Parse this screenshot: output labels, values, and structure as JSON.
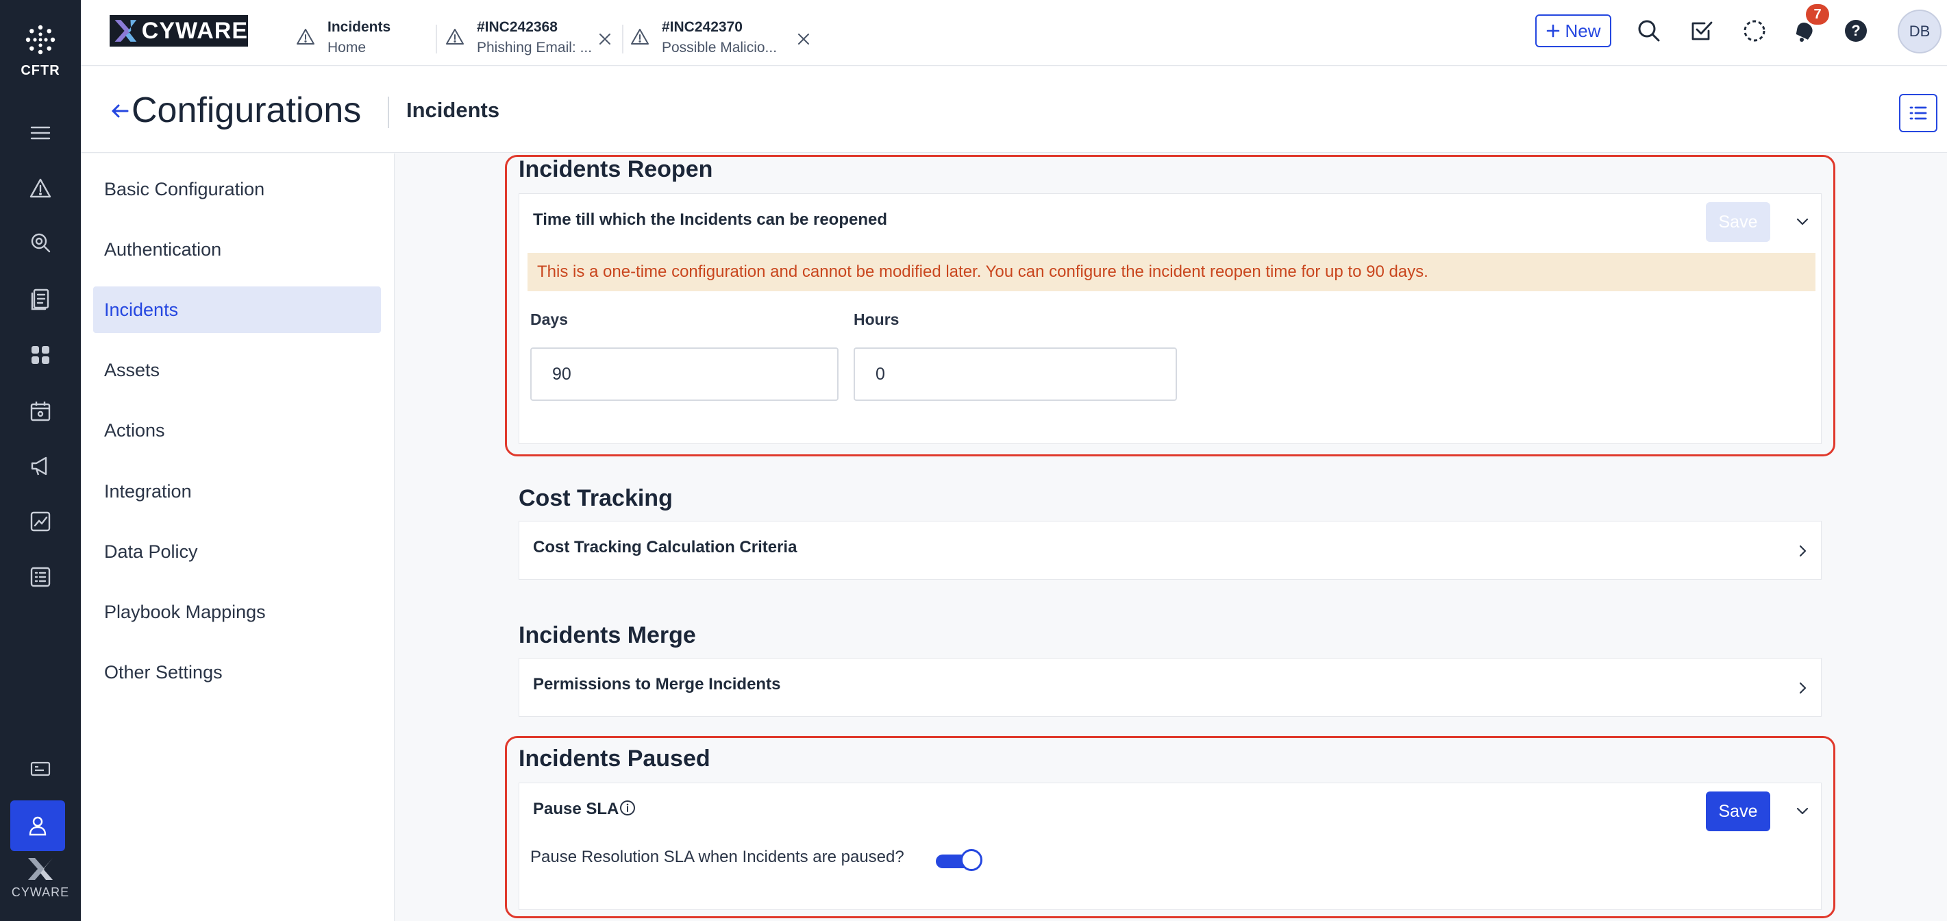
{
  "rail": {
    "brand_short": "CFTR",
    "bottom_brand": "CYWARE"
  },
  "header": {
    "brand": "CYWARE",
    "tabs": [
      {
        "title": "Incidents",
        "subtitle": "Home"
      },
      {
        "title": "#INC242368",
        "subtitle": "Phishing Email: ..."
      },
      {
        "title": "#INC242370",
        "subtitle": "Possible Malicio..."
      }
    ],
    "new_label": "New",
    "notification_count": "7",
    "avatar_initials": "DB"
  },
  "titlebar": {
    "title": "Configurations",
    "subtitle": "Incidents"
  },
  "nav": {
    "items": [
      {
        "label": "Basic Configuration"
      },
      {
        "label": "Authentication"
      },
      {
        "label": "Incidents"
      },
      {
        "label": "Assets"
      },
      {
        "label": "Actions"
      },
      {
        "label": "Integration"
      },
      {
        "label": "Data Policy"
      },
      {
        "label": "Playbook Mappings"
      },
      {
        "label": "Other Settings"
      }
    ],
    "active": "Incidents"
  },
  "sections": {
    "reopen": {
      "title": "Incidents Reopen",
      "panel_label": "Time till which the Incidents can be reopened",
      "save_label": "Save",
      "warning": "This is a one-time configuration and cannot be modified later. You can configure the incident reopen time for up to 90 days.",
      "days_label": "Days",
      "days_value": "90",
      "hours_label": "Hours",
      "hours_value": "0"
    },
    "cost": {
      "title": "Cost Tracking",
      "panel_label": "Cost Tracking Calculation Criteria"
    },
    "merge": {
      "title": "Incidents Merge",
      "panel_label": "Permissions to Merge Incidents"
    },
    "paused": {
      "title": "Incidents Paused",
      "panel_label": "Pause SLA",
      "save_label": "Save",
      "toggle_label": "Pause Resolution SLA when Incidents are paused?",
      "toggle_on": true
    }
  },
  "colors": {
    "accent": "#2547e0",
    "highlight": "#e0392c",
    "warning_bg": "#f7ead4",
    "warning_text": "#c9461e",
    "rail_bg": "#1b2331"
  }
}
